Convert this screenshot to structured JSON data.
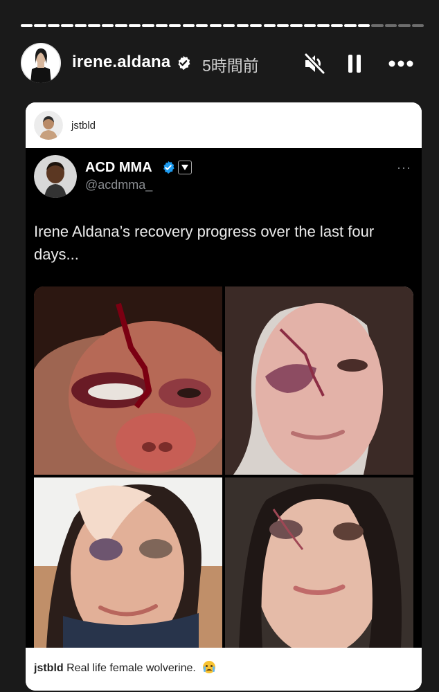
{
  "story": {
    "progress": 0.85,
    "user": {
      "username": "irene.aldana",
      "verified": true
    },
    "time_ago": "5時間前",
    "controls": [
      "mute-icon",
      "pause-icon",
      "more-icon"
    ]
  },
  "repost": {
    "username": "jstbld",
    "caption": "Real life female wolverine."
  },
  "tweet": {
    "name": "ACD MMA",
    "handle": "@acdmma_",
    "verified": true,
    "text": "Irene Aldana’s recovery progress over the last four days...",
    "photos": 4,
    "more_label": "···"
  },
  "colors": {
    "background": "#1a1a1a",
    "verified_blue": "#1d9bf0",
    "card_white": "#ffffff",
    "tweet_black": "#000000"
  }
}
